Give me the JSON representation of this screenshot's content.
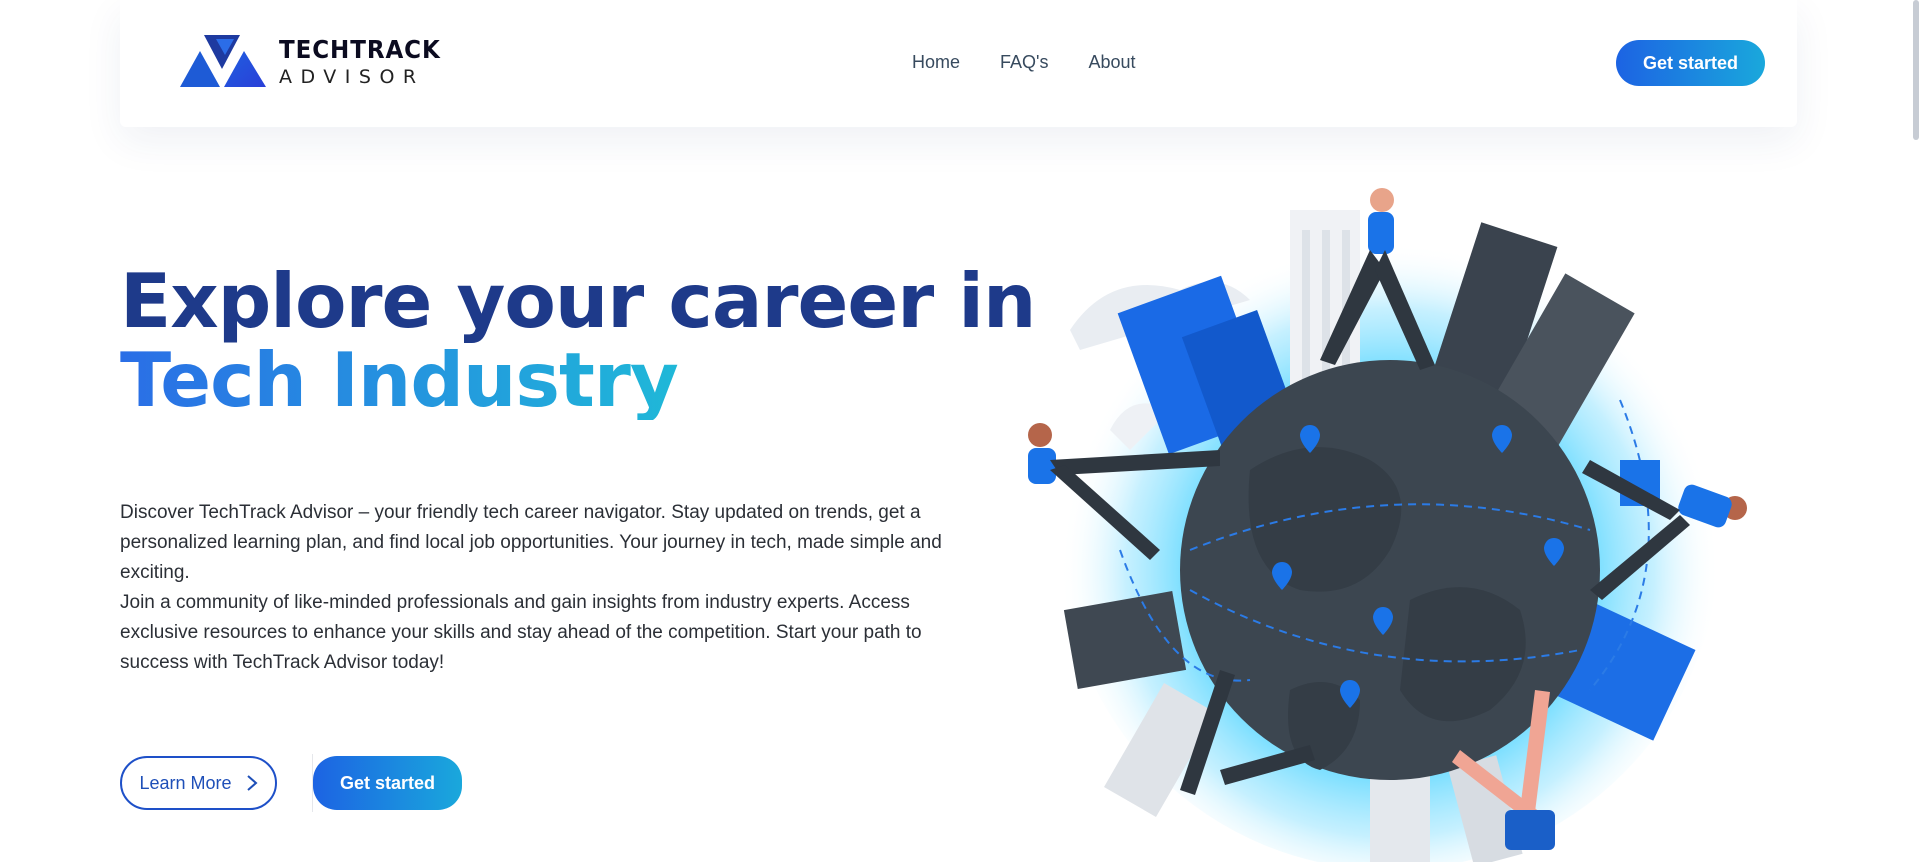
{
  "brand": {
    "name_line1": "TECHTRACK",
    "name_line2": "ADVISOR",
    "colors": {
      "primary": "#1e3a8a",
      "gradient_start": "#1c63e3",
      "gradient_end": "#1aa8dc"
    }
  },
  "nav": {
    "items": [
      {
        "label": "Home"
      },
      {
        "label": "FAQ's"
      },
      {
        "label": "About"
      }
    ],
    "cta_label": "Get started"
  },
  "hero": {
    "title_line1": "Explore your career in",
    "title_line2": "Tech Industry",
    "paragraph1": "Discover TechTrack Advisor – your friendly tech career navigator. Stay updated on trends, get a personalized learning plan, and find local job opportunities. Your journey in tech, made simple and exciting.",
    "paragraph2": "Join a community of like-minded professionals and gain insights from industry experts. Access exclusive resources to enhance your skills and stay ahead of the competition. Start your path to success with TechTrack Advisor today!",
    "learn_more_label": "Learn More",
    "get_started_label": "Get started"
  },
  "icons": {
    "logo": "techtrack-logo-icon",
    "learn_more_arrow": "chevron-right-icon",
    "map_pins": "map-pin-icon"
  }
}
